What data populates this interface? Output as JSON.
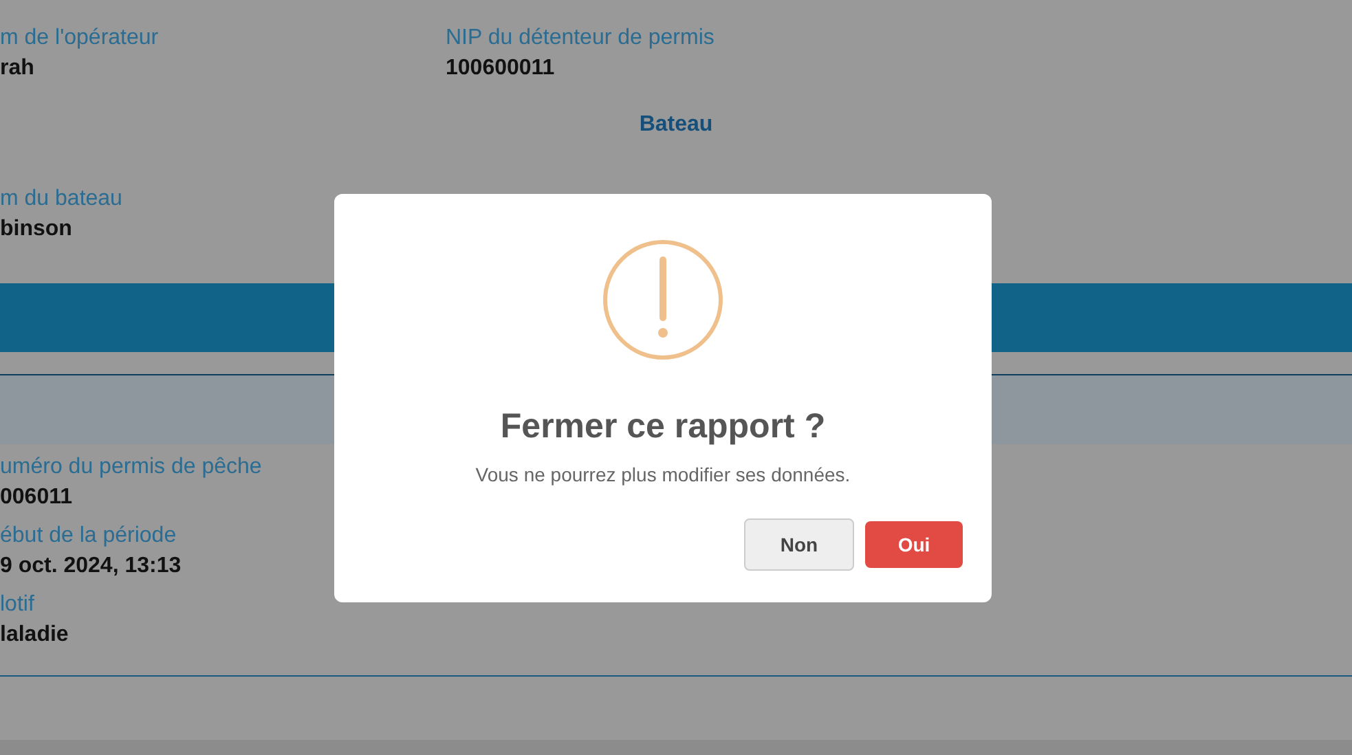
{
  "operator_section": {
    "fields": [
      {
        "label": "m de l'opérateur",
        "value": "rah"
      },
      {
        "label": "NIP du détenteur de permis",
        "value": "100600011"
      }
    ]
  },
  "boat_section": {
    "heading": "Bateau",
    "fields": [
      {
        "label": "m du bateau",
        "value": "binson"
      }
    ]
  },
  "permit_section": {
    "fields": [
      {
        "label": "uméro du permis de pêche",
        "value": "006011"
      },
      {
        "label": "ébut de la période",
        "value": "9 oct. 2024, 13:13"
      },
      {
        "label": "lotif",
        "value": "laladie"
      }
    ]
  },
  "dialog": {
    "title": "Fermer ce rapport ?",
    "message": "Vous ne pourrez plus modifier ses données.",
    "buttons": [
      {
        "label": "Non",
        "kind": "secondary"
      },
      {
        "label": "Oui",
        "kind": "primary"
      }
    ]
  }
}
